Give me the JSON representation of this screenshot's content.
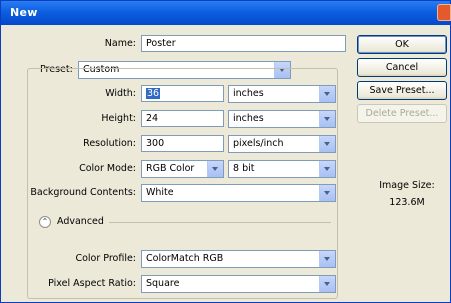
{
  "window": {
    "title": "New",
    "close_icon": "close-icon"
  },
  "form": {
    "name_label": "Name:",
    "name_value": "Poster",
    "preset_label": "Preset:",
    "preset_value": "Custom",
    "width_label": "Width:",
    "width_value": "36",
    "width_unit": "inches",
    "height_label": "Height:",
    "height_value": "24",
    "height_unit": "inches",
    "resolution_label": "Resolution:",
    "resolution_value": "300",
    "resolution_unit": "pixels/inch",
    "color_mode_label": "Color Mode:",
    "color_mode_value": "RGB Color",
    "bit_depth_value": "8 bit",
    "background_label": "Background Contents:",
    "background_value": "White",
    "advanced_label": "Advanced",
    "color_profile_label": "Color Profile:",
    "color_profile_value": "ColorMatch RGB",
    "pixel_aspect_label": "Pixel Aspect Ratio:",
    "pixel_aspect_value": "Square"
  },
  "buttons": {
    "ok": "OK",
    "cancel": "Cancel",
    "save_preset": "Save Preset...",
    "delete_preset": "Delete Preset..."
  },
  "info": {
    "image_size_label": "Image Size:",
    "image_size_value": "123.6M"
  },
  "colors": {
    "titlebar": "#0c5fe0",
    "dialog_bg": "#ece9d8",
    "selection": "#316ac5"
  }
}
